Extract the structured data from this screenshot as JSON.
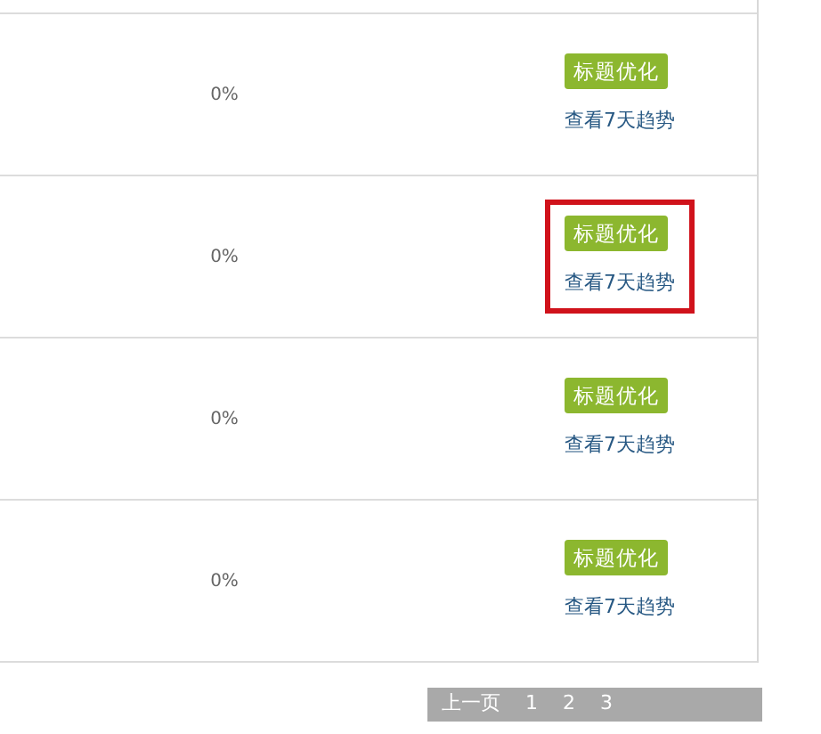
{
  "rows": [
    {
      "percent": "0%",
      "button": "标题优化",
      "link": "查看7天趋势",
      "highlighted": false
    },
    {
      "percent": "0%",
      "button": "标题优化",
      "link": "查看7天趋势",
      "highlighted": true
    },
    {
      "percent": "0%",
      "button": "标题优化",
      "link": "查看7天趋势",
      "highlighted": false
    },
    {
      "percent": "0%",
      "button": "标题优化",
      "link": "查看7天趋势",
      "highlighted": false
    }
  ],
  "pagination": {
    "prev": "上一页",
    "pages": [
      "1",
      "2",
      "3"
    ]
  }
}
